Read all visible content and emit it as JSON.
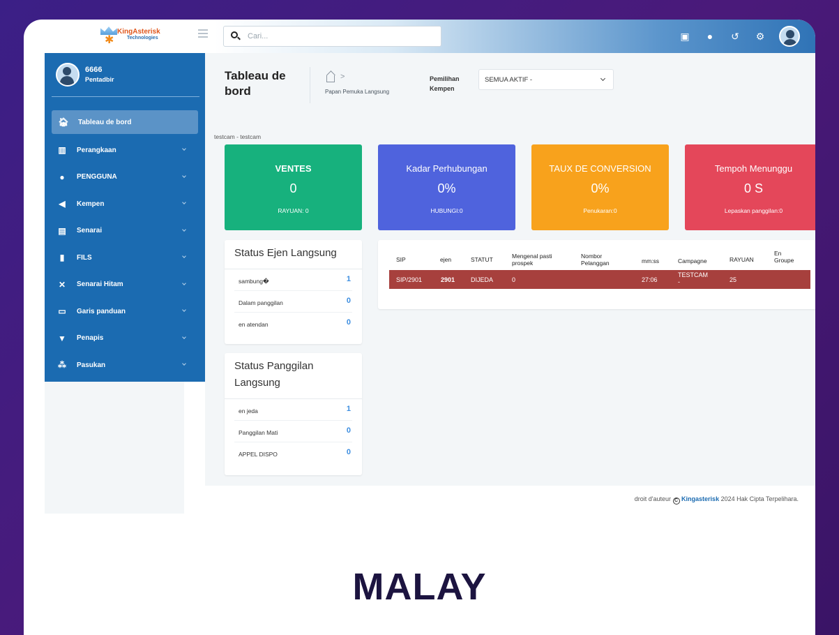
{
  "brand": {
    "name": "KingAsterisk",
    "sub": "Technologies"
  },
  "search": {
    "placeholder": "Cari..."
  },
  "user": {
    "id": "6666",
    "role": "Pentadbir"
  },
  "sidebar": {
    "items": [
      {
        "label": "Tableau de bord",
        "icon": "home-icon",
        "active": true
      },
      {
        "label": "Perangkaan",
        "icon": "chart-icon"
      },
      {
        "label": "PENGGUNA",
        "icon": "user-icon"
      },
      {
        "label": "Kempen",
        "icon": "megaphone-icon"
      },
      {
        "label": "Senarai",
        "icon": "list-icon"
      },
      {
        "label": "FILS",
        "icon": "file-icon"
      },
      {
        "label": "Senarai Hitam",
        "icon": "blocked-phone-icon"
      },
      {
        "label": "Garis panduan",
        "icon": "card-icon"
      },
      {
        "label": "Penapis",
        "icon": "filter-icon"
      },
      {
        "label": "Pasukan",
        "icon": "team-icon"
      }
    ]
  },
  "header": {
    "title": "Tableau de bord",
    "breadcrumb": "Papan Pemuka Langsung",
    "campaign_label_1": "Pemilihan",
    "campaign_label_2": "Kempen",
    "campaign_value": "SEMUA AKTIF -"
  },
  "campaign_name": "testcam - testcam",
  "stats": [
    {
      "title": "VENTES",
      "value": "0",
      "sub": "RAYUAN: 0",
      "color": "#17b17d"
    },
    {
      "title": "Kadar Perhubungan",
      "value": "0%",
      "sub": "HUBUNGI:0",
      "color": "#4f63dd"
    },
    {
      "title": "TAUX DE CONVERSION",
      "value": "0%",
      "sub": "Penukaran:0",
      "color": "#f8a21c"
    },
    {
      "title": "Tempoh Menunggu",
      "value": "0 S",
      "sub": "Lepaskan panggilan:0",
      "color": "#e4475a"
    }
  ],
  "agent_status": {
    "title": "Status Ejen Langsung",
    "rows": [
      {
        "label": "sambung�",
        "value": "1"
      },
      {
        "label": "Dalam panggilan",
        "value": "0"
      },
      {
        "label": "en atendan",
        "value": "0"
      }
    ]
  },
  "call_status": {
    "title_1": "Status Panggilan",
    "title_2": "Langsung",
    "rows": [
      {
        "label": "en jeda",
        "value": "1"
      },
      {
        "label": "Panggilan Mati",
        "value": "0"
      },
      {
        "label": "APPEL DISPO",
        "value": "0"
      }
    ]
  },
  "table": {
    "headers": {
      "sip": "SIP",
      "ejen": "ejen",
      "statut": "STATUT",
      "mengenal_1": "Mengenal pasti",
      "mengenal_2": "prospek",
      "nombor_1": "Nombor",
      "nombor_2": "Pelanggan",
      "mmss": "mm:ss",
      "campagne": "Campagne",
      "rayuan": "RAYUAN",
      "groupe_1": "En",
      "groupe_2": "Groupe"
    },
    "row": {
      "sip": "SIP/2901",
      "ejen": "2901",
      "statut": "DIJEDA",
      "mengenal": "0",
      "nombor": "",
      "mmss": "27:06",
      "campagne_1": "TESTCAM",
      "campagne_2": "-",
      "rayuan": "25",
      "groupe": ""
    }
  },
  "footer": {
    "prefix": "droit d'auteur",
    "brand": "Kingasterisk",
    "suffix": "2024 Hak Cipta Terpelihara."
  },
  "caption": "MALAY"
}
